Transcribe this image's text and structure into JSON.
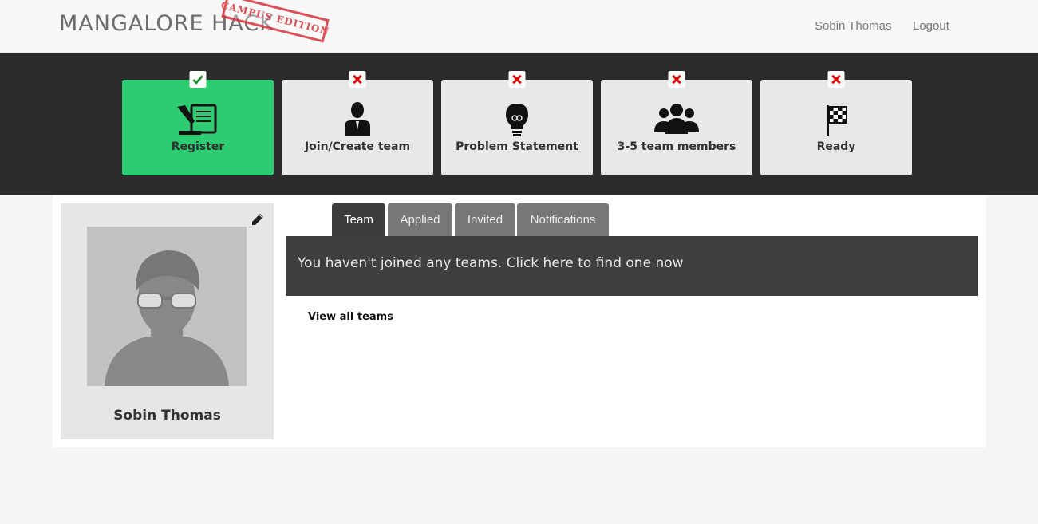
{
  "header": {
    "brand": "MANGALORE HACK",
    "stamp": "CAMPUS EDITION",
    "user_name": "Sobin Thomas",
    "logout_label": "Logout"
  },
  "steps": [
    {
      "label": "Register",
      "status": "done",
      "icon": "register-scroll-icon"
    },
    {
      "label": "Join/Create team",
      "status": "pending",
      "icon": "person-icon"
    },
    {
      "label": "Problem Statement",
      "status": "pending",
      "icon": "lightbulb-icon"
    },
    {
      "label": "3-5 team members",
      "status": "pending",
      "icon": "group-icon"
    },
    {
      "label": "Ready",
      "status": "pending",
      "icon": "checkered-flag-icon"
    }
  ],
  "profile": {
    "name": "Sobin Thomas"
  },
  "tabs": [
    {
      "label": "Team",
      "active": true
    },
    {
      "label": "Applied",
      "active": false
    },
    {
      "label": "Invited",
      "active": false
    },
    {
      "label": "Notifications",
      "active": false
    }
  ],
  "team_panel": {
    "message": "You haven't joined any teams. Click here to find one now"
  },
  "view_all_label": "View all teams",
  "colors": {
    "done": "#2ecc71",
    "pending": "#e8e8e8",
    "band": "#2b2b2b",
    "cross": "#e00000",
    "check": "#1a8a2a",
    "stamp": "#d8343b"
  }
}
